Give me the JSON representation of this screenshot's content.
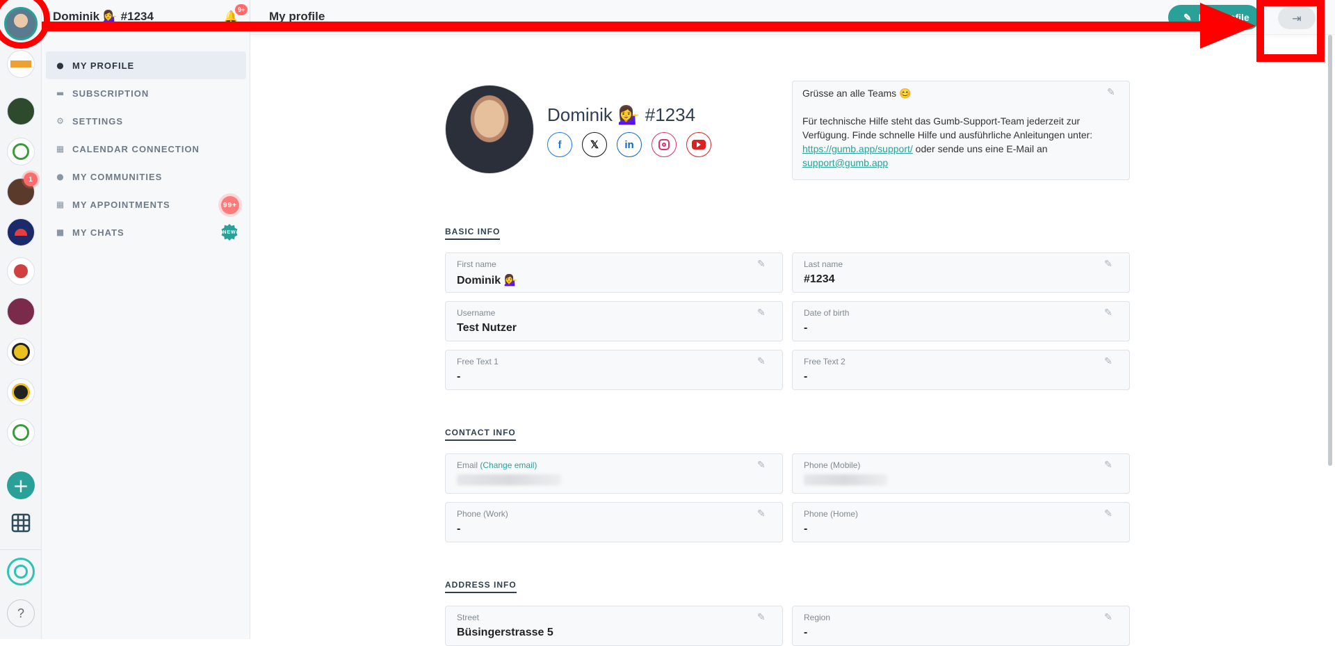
{
  "user": {
    "display_name": "Dominik 💁‍♀️ #1234",
    "notifications_badge": "9+"
  },
  "topbar": {
    "title": "My profile",
    "edit_label": "Edit profile"
  },
  "rail": {
    "community_badge": "1",
    "add_label": "+",
    "help_label": "?"
  },
  "sidebar": {
    "items": [
      {
        "label": "MY PROFILE",
        "icon": "person-icon"
      },
      {
        "label": "SUBSCRIPTION",
        "icon": "card-icon"
      },
      {
        "label": "SETTINGS",
        "icon": "gear-icon"
      },
      {
        "label": "CALENDAR CONNECTION",
        "icon": "calendar-icon"
      },
      {
        "label": "MY COMMUNITIES",
        "icon": "people-icon"
      },
      {
        "label": "MY APPOINTMENTS",
        "icon": "calendar-icon",
        "badge": "99+"
      },
      {
        "label": "MY CHATS",
        "icon": "chat-icon",
        "badge": "NEW"
      }
    ]
  },
  "profile": {
    "name": "Dominik 💁‍♀️ #1234",
    "bio_greeting": "Grüsse an alle Teams 😊",
    "bio_text": "Für technische Hilfe steht das Gumb-Support-Team jederzeit zur Verfügung. Finde schnelle Hilfe und ausführliche Anleitungen unter:",
    "bio_link": "https://gumb.app/support/",
    "bio_mid": " oder sende uns eine E-Mail an ",
    "bio_email": "support@gumb.app"
  },
  "basic_info": {
    "title": "BASIC INFO",
    "fields": [
      {
        "label": "First name",
        "value": "Dominik 💁‍♀️"
      },
      {
        "label": "Last name",
        "value": "#1234"
      },
      {
        "label": "Username",
        "value": "Test Nutzer"
      },
      {
        "label": "Date of birth",
        "value": "-"
      },
      {
        "label": "Free Text 1",
        "value": "-"
      },
      {
        "label": "Free Text 2",
        "value": "-"
      }
    ]
  },
  "contact_info": {
    "title": "CONTACT INFO",
    "email_label": "Email",
    "email_change": "(Change email)",
    "fields": [
      {
        "label": "Phone (Mobile)",
        "value": ""
      },
      {
        "label": "Phone (Work)",
        "value": "-"
      },
      {
        "label": "Phone (Home)",
        "value": "-"
      }
    ]
  },
  "address_info": {
    "title": "ADDRESS INFO",
    "fields": [
      {
        "label": "Street",
        "value": "Büsingerstrasse 5"
      },
      {
        "label": "Region",
        "value": "-"
      }
    ]
  },
  "colors": {
    "accent": "#2aa198",
    "badge": "#ff6b6b",
    "annotation": "#ff0000"
  }
}
